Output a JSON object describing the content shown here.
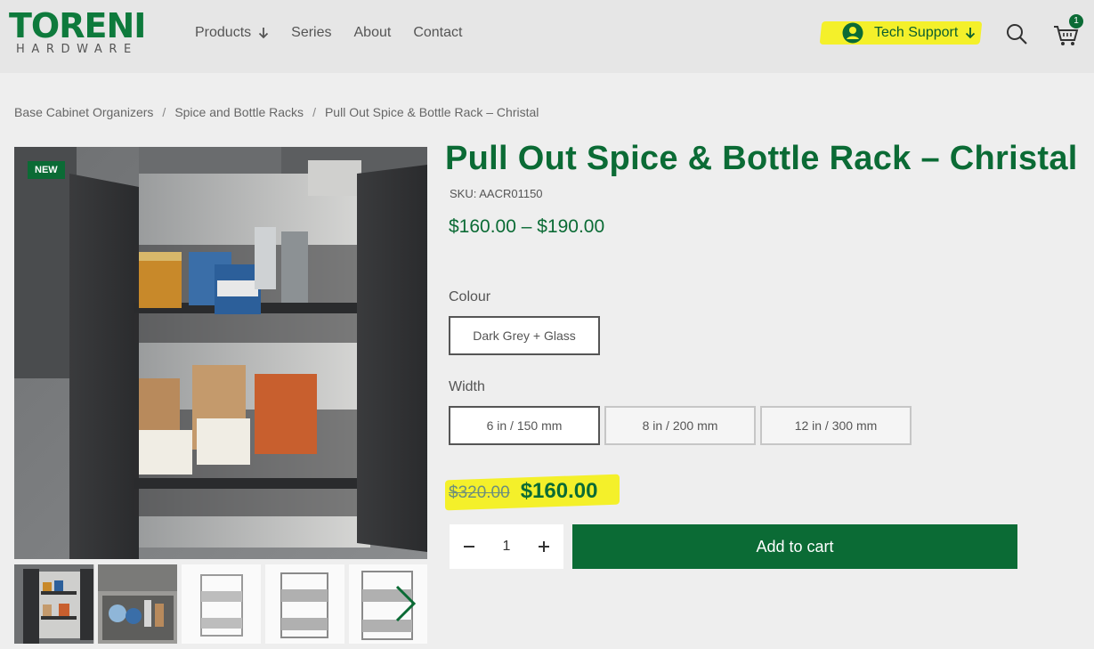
{
  "brand": {
    "name": "TORENI",
    "sub": "HARDWARE"
  },
  "nav": {
    "items": [
      {
        "label": "Products",
        "has_dropdown": true
      },
      {
        "label": "Series",
        "has_dropdown": false
      },
      {
        "label": "About",
        "has_dropdown": false
      },
      {
        "label": "Contact",
        "has_dropdown": false
      }
    ]
  },
  "header": {
    "support_label": "Tech Support",
    "cart_count": "1",
    "icons": [
      "user-circle-icon",
      "search-icon",
      "cart-icon"
    ]
  },
  "breadcrumb": {
    "items": [
      "Base Cabinet Organizers",
      "Spice and Bottle Racks",
      "Pull Out Spice & Bottle Rack – Christal"
    ],
    "separator": "/"
  },
  "product": {
    "badge": "NEW",
    "title": "Pull Out Spice & Bottle Rack – Christal",
    "sku": "SKU: AACR01150",
    "price_range": "$160.00 – $190.00",
    "colour": {
      "label": "Colour",
      "options": [
        "Dark Grey + Glass"
      ],
      "selected": "Dark Grey + Glass"
    },
    "width": {
      "label": "Width",
      "options": [
        "6 in / 150 mm",
        "8 in / 200 mm",
        "12 in / 300 mm"
      ],
      "selected": "6 in / 150 mm"
    },
    "old_price": "$320.00",
    "new_price": "$160.00",
    "quantity": "1",
    "add_to_cart": "Add to cart"
  },
  "colors": {
    "brand_green": "#0b6b35",
    "highlight_yellow": "#f4f02a",
    "header_bg": "#e6e6e6",
    "page_bg": "#eeeeee"
  }
}
